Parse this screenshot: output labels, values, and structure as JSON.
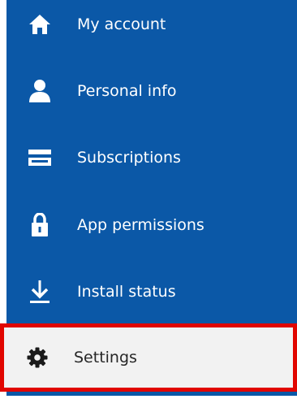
{
  "nav": {
    "items": [
      {
        "label": "My account",
        "icon": "home-icon"
      },
      {
        "label": "Personal info",
        "icon": "person-icon"
      },
      {
        "label": "Subscriptions",
        "icon": "card-icon"
      },
      {
        "label": "App permissions",
        "icon": "lock-icon"
      },
      {
        "label": "Install status",
        "icon": "download-icon"
      },
      {
        "label": "Settings",
        "icon": "gear-icon",
        "selected": true
      }
    ]
  },
  "colors": {
    "nav_background": "#0b58a7",
    "selected_background": "#f2f2f2",
    "highlight_border": "#e10600"
  }
}
